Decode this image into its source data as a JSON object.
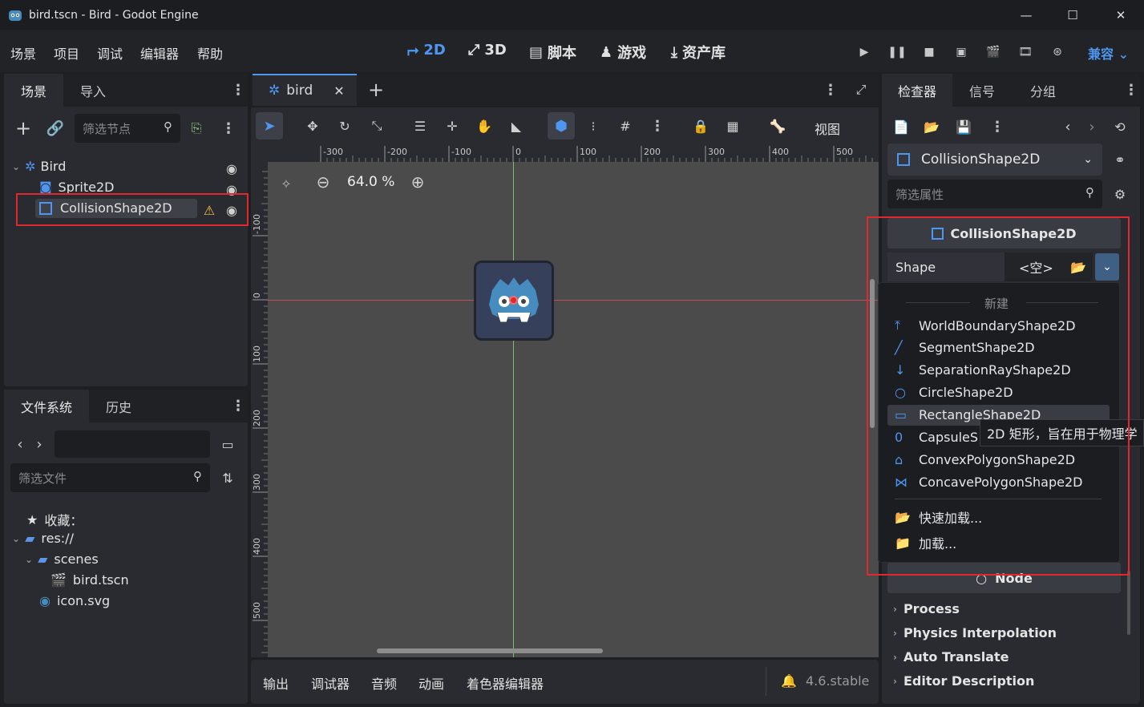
{
  "window": {
    "title": "bird.tscn - Bird - Godot Engine",
    "minimize": "—",
    "maximize": "☐",
    "close": "✕"
  },
  "menu": [
    "场景",
    "项目",
    "调试",
    "编辑器",
    "帮助"
  ],
  "workspaces": [
    {
      "label": "2D",
      "icon": "2d-icon",
      "active": true
    },
    {
      "label": "3D",
      "icon": "3d-icon"
    },
    {
      "label": "脚本",
      "icon": "script-icon"
    },
    {
      "label": "游戏",
      "icon": "game-icon"
    },
    {
      "label": "资产库",
      "icon": "asset-lib-icon"
    }
  ],
  "renderer": "兼容",
  "scene_dock": {
    "tabs": [
      "场景",
      "导入"
    ],
    "filter_placeholder": "筛选节点",
    "nodes": [
      {
        "label": "Bird",
        "icon": "node2d-icon"
      },
      {
        "label": "Sprite2D",
        "icon": "sprite2d-icon"
      },
      {
        "label": "CollisionShape2D",
        "icon": "collisionshape2d-icon",
        "selected": true,
        "warning": true
      }
    ]
  },
  "filesystem_dock": {
    "tabs": [
      "文件系统",
      "历史"
    ],
    "filter_placeholder": "筛选文件",
    "items": [
      {
        "label": "收藏：",
        "icon": "star-icon"
      },
      {
        "label": "res://",
        "icon": "folder-icon"
      },
      {
        "label": "scenes",
        "icon": "folder-icon"
      },
      {
        "label": "bird.tscn",
        "icon": "scene-file-icon"
      },
      {
        "label": "icon.svg",
        "icon": "godot-icon"
      }
    ]
  },
  "editor": {
    "tab_label": "bird",
    "view_menu": "视图",
    "zoom": "64.0 %",
    "ruler_x": [
      "-300",
      "-200",
      "-100",
      "0",
      "100",
      "200",
      "300",
      "400",
      "500"
    ],
    "ruler_y": [
      "-100",
      "0",
      "100",
      "200",
      "300",
      "400",
      "500"
    ]
  },
  "bottom_panel": {
    "tabs": [
      "输出",
      "调试器",
      "音频",
      "动画",
      "着色器编辑器"
    ],
    "version": "4.6.stable"
  },
  "inspector": {
    "tabs": [
      "检查器",
      "信号",
      "分组"
    ],
    "object": "CollisionShape2D",
    "filter_placeholder": "筛选属性",
    "section_header": "CollisionShape2D",
    "property_label": "Shape",
    "property_value": "<空>",
    "dropdown": {
      "header": "新建",
      "items": [
        {
          "label": "WorldBoundaryShape2D",
          "icon": "world-boundary-icon"
        },
        {
          "label": "SegmentShape2D",
          "icon": "segment-icon"
        },
        {
          "label": "SeparationRayShape2D",
          "icon": "separation-ray-icon"
        },
        {
          "label": "CircleShape2D",
          "icon": "circle-icon"
        },
        {
          "label": "RectangleShape2D",
          "icon": "rectangle-icon"
        },
        {
          "label": "CapsuleS",
          "icon": "capsule-icon"
        },
        {
          "label": "ConvexPolygonShape2D",
          "icon": "convex-polygon-icon"
        },
        {
          "label": "ConcavePolygonShape2D",
          "icon": "concave-polygon-icon"
        }
      ],
      "load_items": [
        "快速加载...",
        "加载..."
      ],
      "tooltip": "2D 矩形，旨在用于物理学"
    },
    "node_section": "Node",
    "groups": [
      "Process",
      "Physics Interpolation",
      "Auto Translate",
      "Editor Description"
    ]
  },
  "colors": {
    "accent": "#4e96f0",
    "highlight_box": "#e0282d",
    "viewport_bg": "#4b4b4b"
  }
}
